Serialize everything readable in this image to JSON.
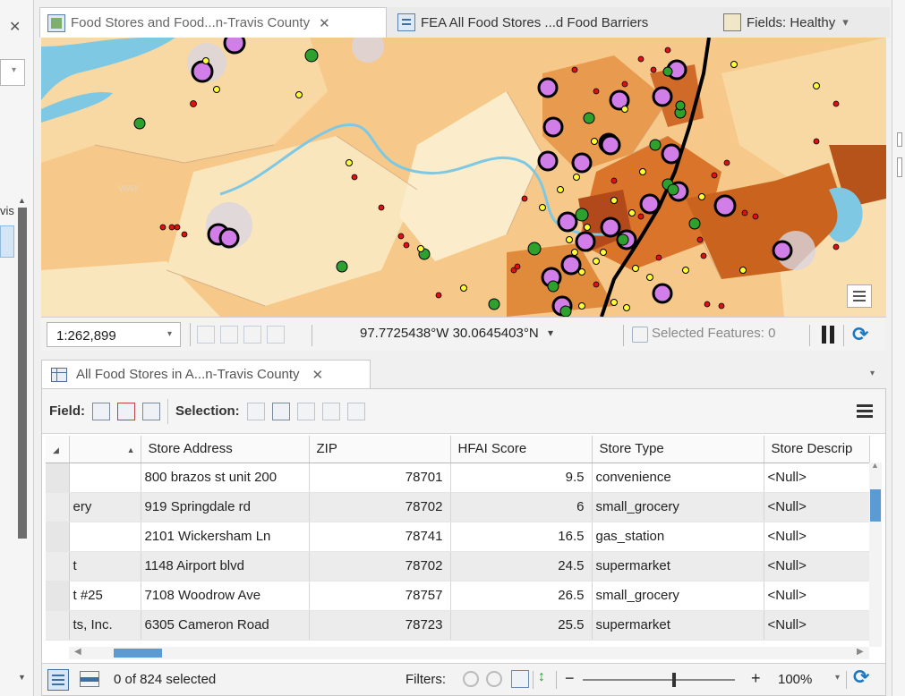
{
  "left_pane": {
    "close_glyph": "✕",
    "partial_text": "vis"
  },
  "tabs": [
    {
      "label": "Food Stores and Food...n-Travis County",
      "close": "✕"
    },
    {
      "label": "FEA All Food Stores ...d Food Barriers"
    },
    {
      "label": "Fields:  Healthy"
    }
  ],
  "map_status": {
    "scale": "1:262,899",
    "coords": "97.7725438°W 30.0645403°N",
    "selected": "Selected Features: 0"
  },
  "table_tab": {
    "label": "All Food Stores in A...n-Travis County",
    "close": "✕"
  },
  "ribbon": {
    "field_label": "Field:",
    "selection_label": "Selection:"
  },
  "table": {
    "columns": [
      "",
      "Store Address",
      "ZIP",
      "HFAI Score",
      "Store Type",
      "Store Descrip"
    ],
    "rows": [
      {
        "name": "",
        "address": "800 brazos st unit 200",
        "zip": "78701",
        "hfai": "9.5",
        "type": "convenience",
        "descrip": "<Null>"
      },
      {
        "name": "ery",
        "address": "919 Springdale rd",
        "zip": "78702",
        "hfai": "6",
        "type": "small_grocery",
        "descrip": "<Null>"
      },
      {
        "name": "",
        "address": "2101 Wickersham Ln",
        "zip": "78741",
        "hfai": "16.5",
        "type": "gas_station",
        "descrip": "<Null>"
      },
      {
        "name": "t",
        "address": "1148 Airport blvd",
        "zip": "78702",
        "hfai": "24.5",
        "type": "supermarket",
        "descrip": "<Null>"
      },
      {
        "name": "t #25",
        "address": "7108 Woodrow Ave",
        "zip": "78757",
        "hfai": "26.5",
        "type": "small_grocery",
        "descrip": "<Null>"
      },
      {
        "name": "ts, Inc.",
        "address": "6305 Cameron Road",
        "zip": "78723",
        "hfai": "25.5",
        "type": "supermarket",
        "descrip": "<Null>"
      }
    ]
  },
  "footer": {
    "selected_text": "0 of 824 selected",
    "filters_label": "Filters:",
    "minus": "−",
    "plus": "+",
    "zoom": "100%"
  },
  "colors": {
    "map_orange": "#f6c98a",
    "river": "#7ec8e3",
    "highlight_purple": "#d27ee8",
    "road": "#000000"
  }
}
